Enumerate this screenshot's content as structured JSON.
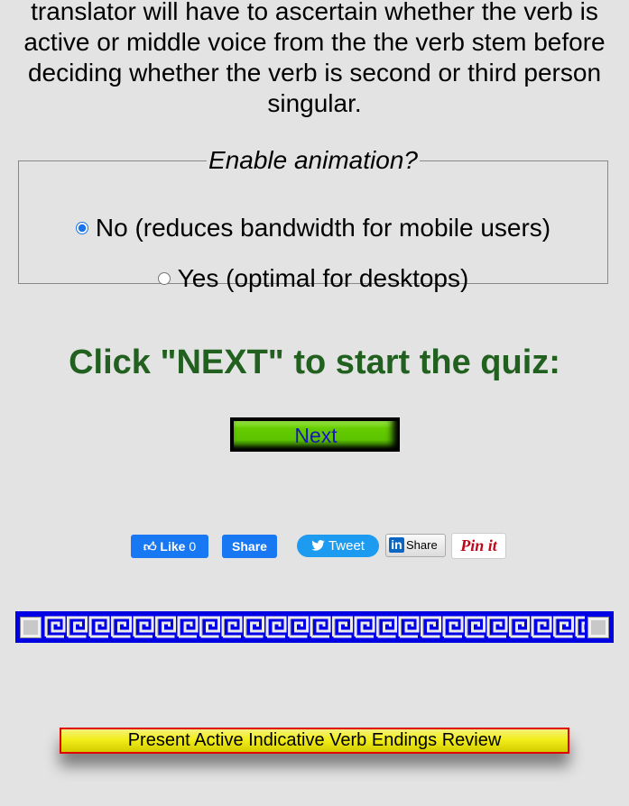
{
  "intro": {
    "text": "translator will have to ascertain whether the verb is active or middle voice from the the verb stem before deciding whether the verb is second or third person singular."
  },
  "animation": {
    "legend": "Enable animation?",
    "options": [
      {
        "label": "No (reduces bandwidth for mobile users)",
        "selected": true
      },
      {
        "label": "Yes (optimal for desktops)",
        "selected": false
      }
    ]
  },
  "cta": {
    "heading": "Click \"NEXT\" to start the quiz:",
    "next_label": "Next"
  },
  "social": {
    "fb_like_label": "Like",
    "fb_like_count": "0",
    "fb_share_label": "Share",
    "tweet_label": "Tweet",
    "linkedin_label": "Share",
    "linkedin_logo": "in",
    "pinterest_label": "Pin it"
  },
  "review_link": {
    "label": "Present Active Indicative Verb Endings Review"
  },
  "colors": {
    "background": "#e3e3e3",
    "heading_green": "#21601f",
    "next_green": "#66cc00",
    "next_text": "#1818b4",
    "border_blue": "#0000e8",
    "review_yellow": "#f2ee1a",
    "review_border": "#e00000"
  }
}
